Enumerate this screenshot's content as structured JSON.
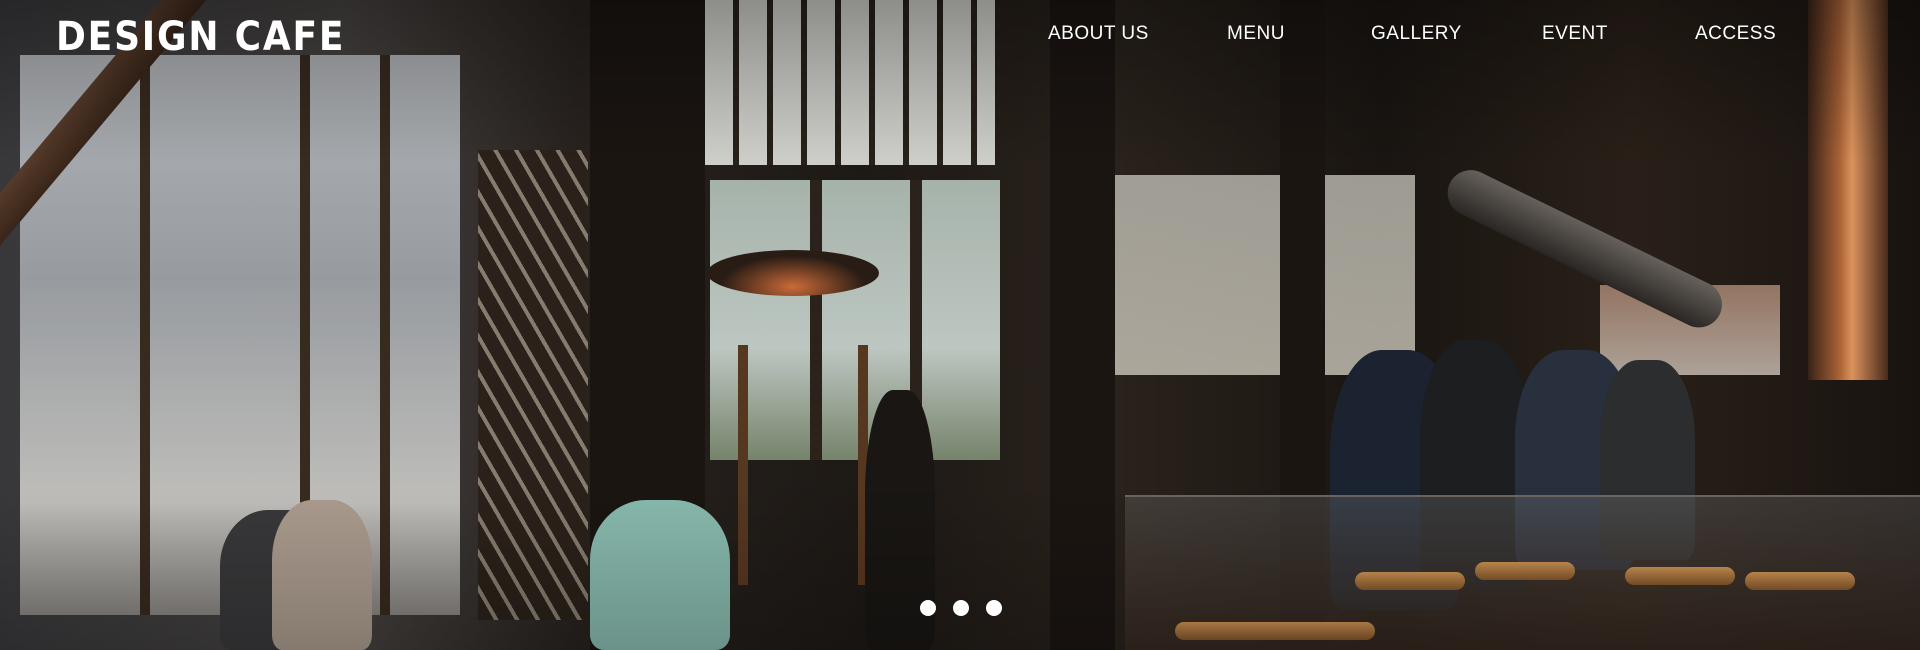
{
  "brand": {
    "logo_text": "DESIGN CAFE"
  },
  "nav": {
    "items": [
      {
        "label": "ABOUT US"
      },
      {
        "label": "MENU"
      },
      {
        "label": "GALLERY"
      },
      {
        "label": "EVENT"
      },
      {
        "label": "ACCESS"
      }
    ]
  },
  "slider": {
    "dot_count": 3,
    "active_index": 0
  },
  "colors": {
    "text": "#ffffff",
    "accent_copper": "#d5703a"
  }
}
